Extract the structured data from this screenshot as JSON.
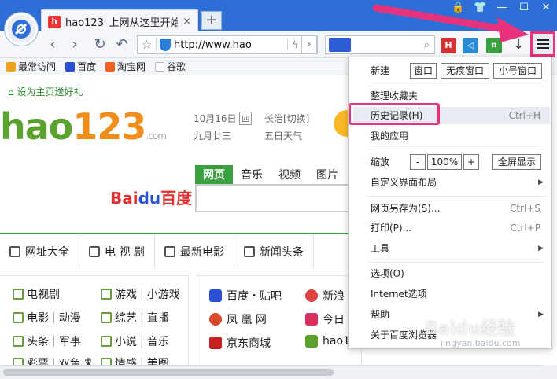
{
  "tab": {
    "title": "hao123_上网从这里开始",
    "close": "×",
    "new": "+"
  },
  "window_controls": [
    "🔒",
    "👕",
    "—",
    "☐",
    "✕"
  ],
  "nav": {
    "back": "‹",
    "forward": "›",
    "refresh": "↻",
    "undo": "↶",
    "url": "http://www.hao",
    "search_engine": "🐾",
    "download": "↓"
  },
  "bookmarks": [
    {
      "label": "最常访问",
      "color": "#f0a020"
    },
    {
      "label": "百度",
      "color": "#2a4fd6"
    },
    {
      "label": "淘宝网",
      "color": "#f06020"
    },
    {
      "label": "谷歌",
      "color": "#cccccc"
    }
  ],
  "page": {
    "set_home": "设为主页送好礼",
    "logo_main": "hao",
    "logo_num": "123",
    "logo_com": ".com",
    "date": "10月16日",
    "weekday": "四",
    "lunar": "九月廿三",
    "city": "长治[切换]",
    "weather": "五日天气",
    "search_tabs": [
      "网页",
      "音乐",
      "视频",
      "图片"
    ],
    "baidu_a": "Bai",
    "baidu_paw": "du",
    "baidu_b": "百度",
    "nav_items": [
      "网址大全",
      "电 视 剧",
      "最新电影",
      "新闻头条"
    ],
    "left_links": [
      [
        "电视剧"
      ],
      [
        "游戏",
        "小游戏"
      ],
      [
        "电影",
        "动漫"
      ],
      [
        "综艺",
        "直播"
      ],
      [
        "头条",
        "军事"
      ],
      [
        "小说",
        "音乐"
      ],
      [
        "彩票",
        "双色球"
      ],
      [
        "情感",
        "美图"
      ]
    ],
    "right_links": [
      "百度・贴吧",
      "新浪",
      "凤 凰 网",
      "今日",
      "京东商城",
      "hao1"
    ]
  },
  "menu": {
    "new_label": "新建",
    "new_window": "窗口",
    "incognito": "无痕窗口",
    "small_window": "小号窗口",
    "organize_bookmarks": "整理收藏夹",
    "history": "历史记录(H)",
    "history_shortcut": "Ctrl+H",
    "my_apps": "我的应用",
    "zoom_label": "缩放",
    "zoom_minus": "-",
    "zoom_value": "100%",
    "zoom_plus": "+",
    "fullscreen": "全屏显示",
    "customize": "自定义界面布局",
    "save_as": "网页另存为(S)...",
    "save_as_shortcut": "Ctrl+S",
    "print": "打印(P)...",
    "print_shortcut": "Ctrl+P",
    "tools": "工具",
    "options": "选项(O)",
    "internet_options": "Internet选项",
    "help": "帮助",
    "about": "关于百度浏览器"
  },
  "watermark": "Baidu经验",
  "watermark_url": "jingyan.baidu.com",
  "colors": {
    "accent": "#2d6fd6",
    "highlight": "#e8327c",
    "green": "#3aa040"
  }
}
